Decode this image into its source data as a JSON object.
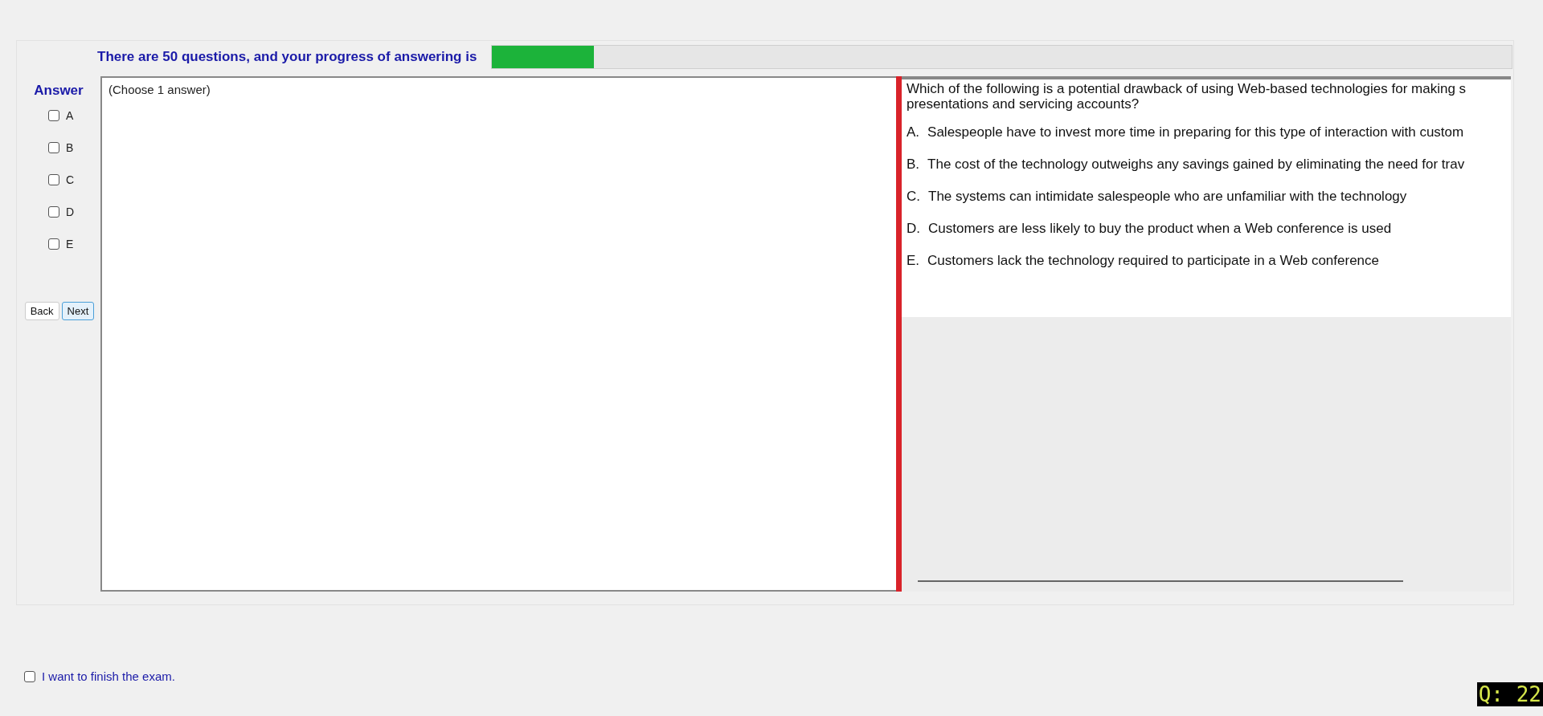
{
  "progress": {
    "label": "There are 50 questions, and your progress of answering is",
    "level": 0.1
  },
  "answer_panel": {
    "title": "Answer",
    "options": [
      {
        "label": "A",
        "checked": false
      },
      {
        "label": "B",
        "checked": false
      },
      {
        "label": "C",
        "checked": false
      },
      {
        "label": "D",
        "checked": false
      },
      {
        "label": "E",
        "checked": false
      }
    ],
    "buttons": [
      {
        "label": "Back",
        "focused": false
      },
      {
        "label": "Next",
        "focused": true
      }
    ]
  },
  "answer_area": {
    "hint": "(Choose 1 answer)"
  },
  "question": {
    "text": [
      "Which of the following is a potential drawback of using Web-based technologies for making s",
      "presentations and servicing accounts?"
    ],
    "choices": [
      {
        "letter": "A.",
        "text": "Salespeople have to invest more time in preparing for this type of interaction with custom"
      },
      {
        "letter": "B.",
        "text": "The cost of the technology outweighs any savings gained by eliminating the need for trav"
      },
      {
        "letter": "C.",
        "text": "The systems can intimidate salespeople who are unfamiliar with the technology"
      },
      {
        "letter": "D.",
        "text": "Customers are less likely to buy the product when a Web conference is used"
      },
      {
        "letter": "E.",
        "text": "Customers lack the technology required to participate in a Web conference"
      }
    ]
  },
  "finish": {
    "label": "I want to finish the exam.",
    "checked": false
  },
  "question_number": "Q: 22"
}
